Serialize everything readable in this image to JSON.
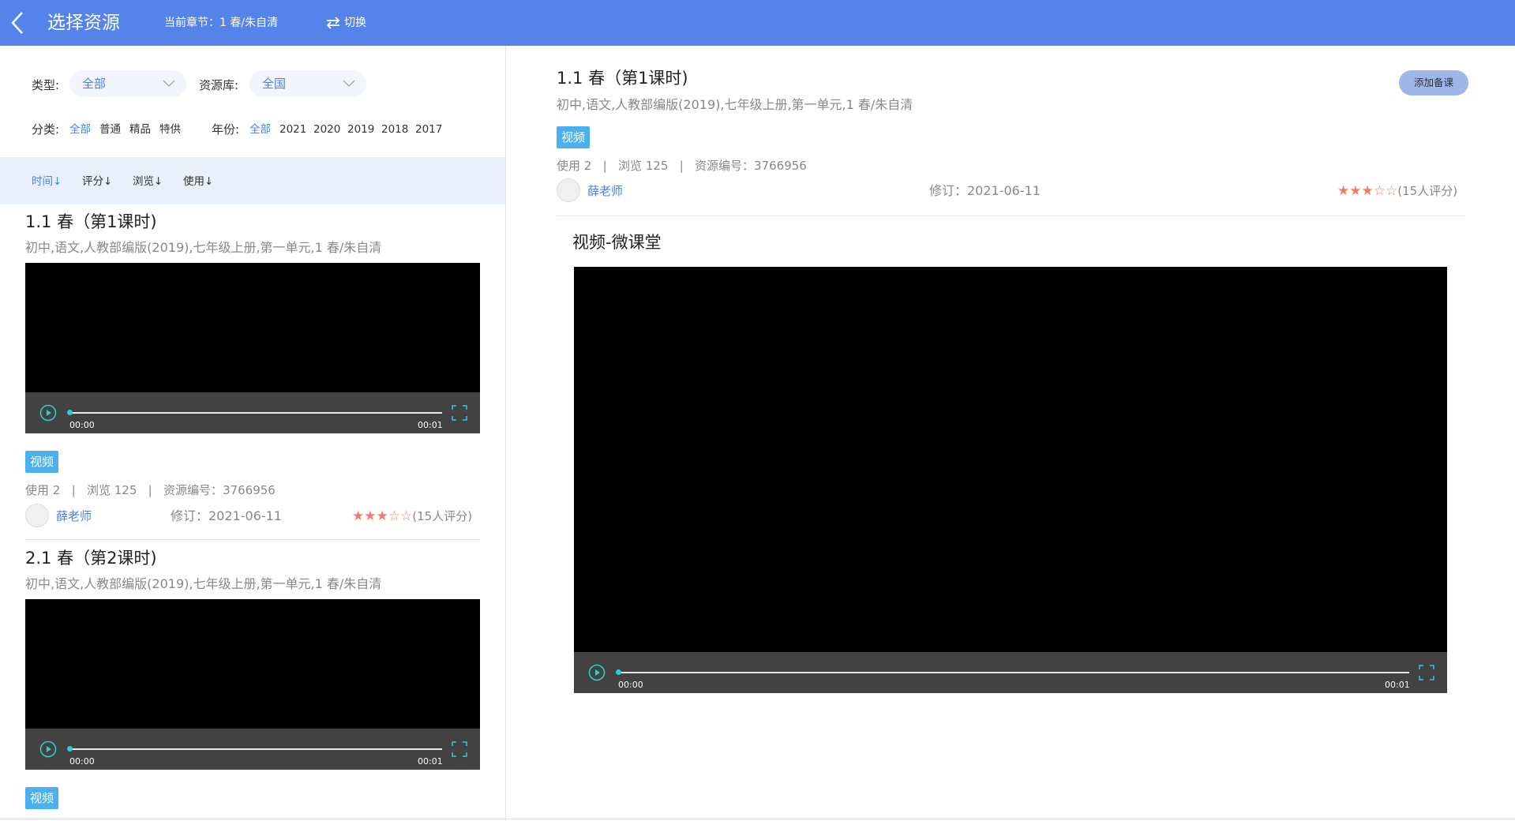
{
  "header": {
    "title": "选择资源",
    "chapter_label": "当前章节：1 春/朱自清",
    "switch_label": "切换"
  },
  "filters": {
    "type_label": "类型:",
    "type_value": "全部",
    "library_label": "资源库:",
    "library_value": "全国",
    "category_label": "分类:",
    "categories": [
      "全部",
      "普通",
      "精品",
      "特供"
    ],
    "year_label": "年份:",
    "years": [
      "全部",
      "2021",
      "2020",
      "2019",
      "2018",
      "2017"
    ]
  },
  "sort": {
    "items": [
      "时间↓",
      "评分↓",
      "浏览↓",
      "使用↓"
    ]
  },
  "list": [
    {
      "title": "1.1 春（第1课时)",
      "path": "初中,语文,人教部编版(2019),七年级上册,第一单元,1 春/朱自清",
      "video": {
        "current": "00:00",
        "duration": "00:01",
        "progress": 0
      },
      "tag": "视频",
      "stats": "使用 2   |   浏览 125   |   资源编号：3766956",
      "teacher": "薛老师",
      "revised": "修订：2021-06-11",
      "rating": 3,
      "rating_count": "(15人评分)"
    },
    {
      "title": "2.1 春（第2课时)",
      "path": "初中,语文,人教部编版(2019),七年级上册,第一单元,1 春/朱自清",
      "video": {
        "current": "00:00",
        "duration": "00:01",
        "progress": 0
      },
      "tag": "视频"
    }
  ],
  "detail": {
    "title": "1.1 春（第1课时)",
    "path": "初中,语文,人教部编版(2019),七年级上册,第一单元,1 春/朱自清",
    "add_button": "添加备课",
    "tag": "视频",
    "stats": "使用 2   |   浏览 125   |   资源编号：3766956",
    "teacher": "薛老师",
    "revised": "修订：2021-06-11",
    "rating": 3,
    "rating_count": "(15人评分)",
    "section_title": "视频-微课堂",
    "video": {
      "current": "00:00",
      "duration": "00:01",
      "progress": 0
    }
  },
  "colors": {
    "header_bg": "#5484ea",
    "accent": "#4a7fe6",
    "tag_bg": "#4bb0ee",
    "star": "#f07b66",
    "player_accent": "#2ad2c9"
  }
}
